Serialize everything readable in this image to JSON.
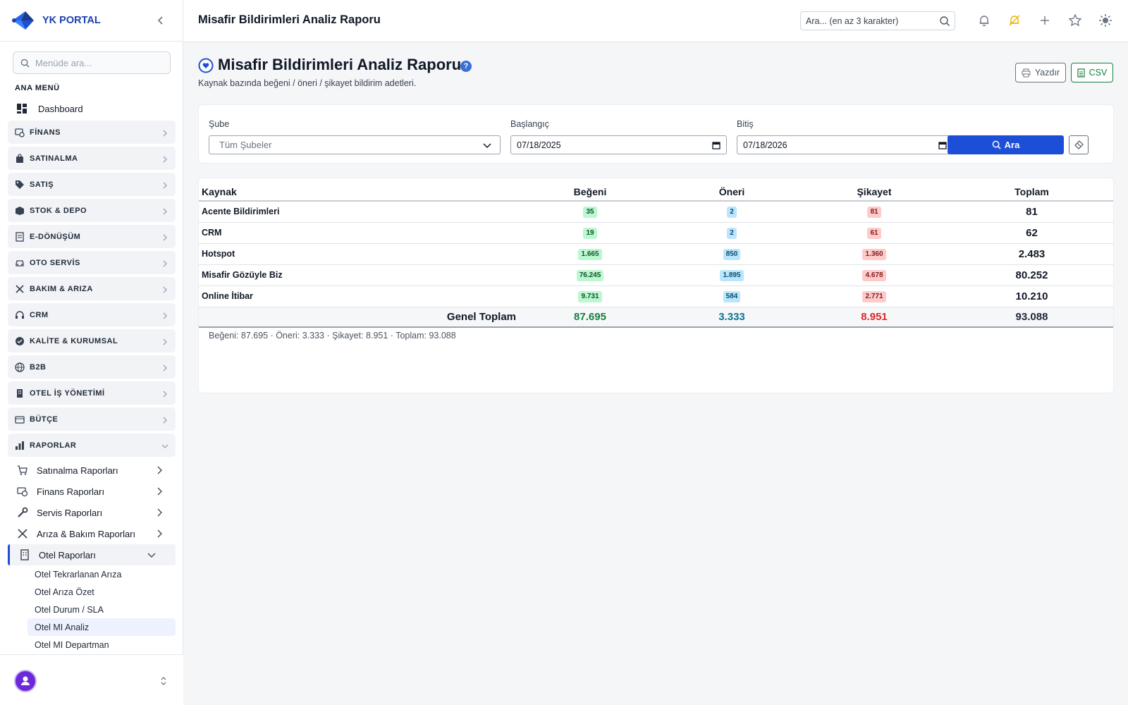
{
  "brand": "YK PORTAL",
  "sidebar": {
    "search_placeholder": "Menüde ara...",
    "section_label": "ANA MENÜ",
    "dashboard": "Dashboard",
    "menus": [
      "FİNANS",
      "SATINALMA",
      "SATIŞ",
      "STOK & DEPO",
      "E-DÖNÜŞÜM",
      "OTO SERVİS",
      "BAKIM & ARIZA",
      "CRM",
      "KALİTE & KURUMSAL",
      "B2B",
      "OTEL İŞ YÖNETİMİ",
      "BÜTÇE",
      "RAPORLAR"
    ],
    "reports": [
      "Satınalma Raporları",
      "Finans Raporları",
      "Servis Raporları",
      "Arıza & Bakım Raporları",
      "Otel Raporları"
    ],
    "hotel_reports": [
      "Otel Tekrarlanan Arıza",
      "Otel Arıza Özet",
      "Otel Durum / SLA",
      "Otel MI Analiz",
      "Otel MI Departman"
    ]
  },
  "topbar": {
    "title": "Misafir Bildirimleri Analiz Raporu",
    "search_placeholder": "Ara... (en az 3 karakter)"
  },
  "page": {
    "title": "Misafir Bildirimleri Analiz Raporu",
    "help": "?",
    "subtitle": "Kaynak bazında beğeni / öneri / şikayet bildirim adetleri.",
    "print_label": "Yazdır",
    "csv_label": "CSV"
  },
  "filters": {
    "branch_label": "Şube",
    "branch_value": "Tüm Şubeler",
    "start_label": "Başlangıç",
    "start_value": "07/18/2025",
    "end_label": "Bitiş",
    "end_value": "07/18/2026",
    "search_label": "Ara"
  },
  "table": {
    "headers": [
      "Kaynak",
      "Beğeni",
      "Öneri",
      "Şikayet",
      "Toplam"
    ],
    "rows": [
      {
        "source": "Acente Bildirimleri",
        "like": "35",
        "suggest": "2",
        "complaint": "81",
        "total": "81"
      },
      {
        "source": "CRM",
        "like": "19",
        "suggest": "2",
        "complaint": "61",
        "total": "62"
      },
      {
        "source": "Hotspot",
        "like": "1.665",
        "suggest": "850",
        "complaint": "1.360",
        "total": "2.483"
      },
      {
        "source": "Misafir Gözüyle Biz",
        "like": "76.245",
        "suggest": "1.895",
        "complaint": "4.678",
        "total": "80.252"
      },
      {
        "source": "Online İtibar",
        "like": "9.731",
        "suggest": "584",
        "complaint": "2.771",
        "total": "10.210"
      }
    ],
    "footer": {
      "label": "Genel Toplam",
      "like": "87.695",
      "suggest": "3.333",
      "complaint": "8.951",
      "total": "93.088"
    },
    "summary": "Beğeni: 87.695 · Öneri: 3.333 · Şikayet: 8.951 · Toplam: 93.088"
  },
  "colors": {
    "accent": "#1d4ed8",
    "like": "#15803d",
    "suggest": "#0e7490",
    "complaint": "#dc2626"
  }
}
